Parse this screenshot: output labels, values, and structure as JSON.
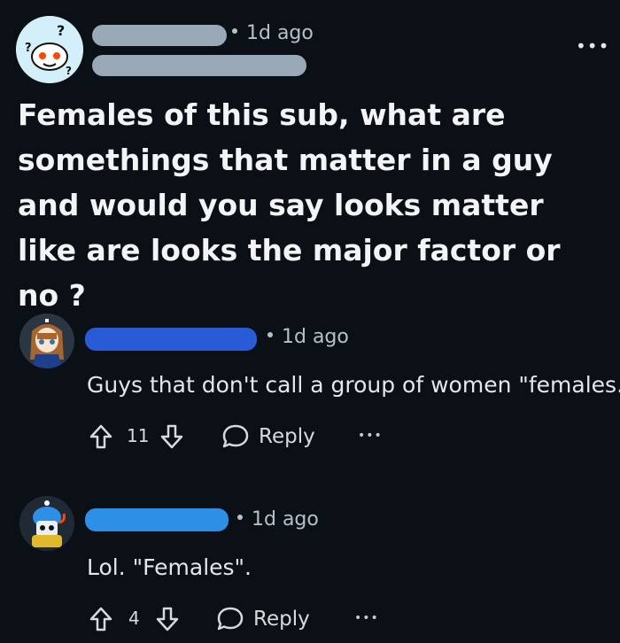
{
  "post": {
    "time": "1d ago",
    "title": "Females of this sub, what are somethings that matter in a guy and would you say looks matter like are looks the major factor or no ?",
    "more_label": "•••"
  },
  "comments": [
    {
      "time": "1d ago",
      "text": "Guys that don't call a group of women \"females.\"",
      "votes": "11",
      "reply_label": "Reply",
      "more_label": "•••",
      "redact_color": "#2a5bd7"
    },
    {
      "time": "1d ago",
      "text": "Lol. \"Females\".",
      "votes": "4",
      "reply_label": "Reply",
      "more_label": "•••",
      "redact_color": "#2e8fe6"
    }
  ],
  "colors": {
    "background": "#0b1016",
    "post_redact": "#9aa9b8"
  }
}
